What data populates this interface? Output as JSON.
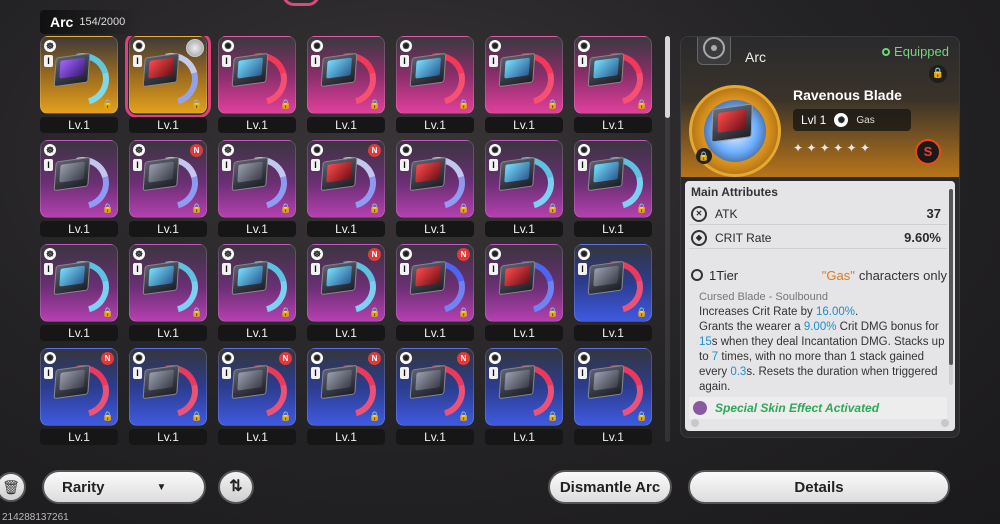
{
  "header": {
    "title": "Arc",
    "count": "154/2000"
  },
  "grid": {
    "items": [
      {
        "lv": "Lv.1",
        "bg": "gold",
        "ring": "c-cyan",
        "face": "violet",
        "elem": "☸",
        "badge": "",
        "selected": false
      },
      {
        "lv": "Lv.1",
        "bg": "gold",
        "ring": "c-white",
        "face": "red",
        "elem": "✺",
        "badge": "deco",
        "selected": true
      },
      {
        "lv": "Lv.1",
        "bg": "pink",
        "ring": "c-red",
        "face": "cyan",
        "elem": "✺",
        "badge": "",
        "selected": false
      },
      {
        "lv": "Lv.1",
        "bg": "pink",
        "ring": "c-red",
        "face": "cyan",
        "elem": "✺",
        "badge": "",
        "selected": false
      },
      {
        "lv": "Lv.1",
        "bg": "pink",
        "ring": "c-red",
        "face": "cyan",
        "elem": "✺",
        "badge": "",
        "selected": false
      },
      {
        "lv": "Lv.1",
        "bg": "pink",
        "ring": "c-red",
        "face": "cyan",
        "elem": "✺",
        "badge": "",
        "selected": false
      },
      {
        "lv": "Lv.1",
        "bg": "pink",
        "ring": "c-red",
        "face": "cyan",
        "elem": "✺",
        "badge": "",
        "selected": false
      },
      {
        "lv": "Lv.1",
        "bg": "purple",
        "ring": "c-white",
        "face": "gray",
        "elem": "☸",
        "badge": "",
        "selected": false
      },
      {
        "lv": "Lv.1",
        "bg": "purple",
        "ring": "c-white",
        "face": "gray",
        "elem": "☸",
        "badge": "N",
        "selected": false
      },
      {
        "lv": "Lv.1",
        "bg": "purple",
        "ring": "c-white",
        "face": "gray",
        "elem": "☸",
        "badge": "",
        "selected": false
      },
      {
        "lv": "Lv.1",
        "bg": "purple",
        "ring": "c-white",
        "face": "red",
        "elem": "✺",
        "badge": "N",
        "selected": false
      },
      {
        "lv": "Lv.1",
        "bg": "purple",
        "ring": "c-white",
        "face": "red",
        "elem": "✺",
        "badge": "",
        "selected": false
      },
      {
        "lv": "Lv.1",
        "bg": "purple",
        "ring": "c-cyan",
        "face": "cyan",
        "elem": "✺",
        "badge": "",
        "selected": false
      },
      {
        "lv": "Lv.1",
        "bg": "purple",
        "ring": "c-cyan",
        "face": "cyan",
        "elem": "✺",
        "badge": "",
        "selected": false
      },
      {
        "lv": "Lv.1",
        "bg": "purple",
        "ring": "c-cyan",
        "face": "cyan",
        "elem": "☸",
        "badge": "",
        "selected": false
      },
      {
        "lv": "Lv.1",
        "bg": "purple",
        "ring": "c-cyan",
        "face": "cyan",
        "elem": "☸",
        "badge": "",
        "selected": false
      },
      {
        "lv": "Lv.1",
        "bg": "purple",
        "ring": "c-cyan",
        "face": "cyan",
        "elem": "☸",
        "badge": "",
        "selected": false
      },
      {
        "lv": "Lv.1",
        "bg": "purple",
        "ring": "c-cyan",
        "face": "cyan",
        "elem": "☸",
        "badge": "N",
        "selected": false
      },
      {
        "lv": "Lv.1",
        "bg": "purple",
        "ring": "c-blue",
        "face": "red",
        "elem": "✺",
        "badge": "N",
        "selected": false
      },
      {
        "lv": "Lv.1",
        "bg": "purple",
        "ring": "c-blue",
        "face": "red",
        "elem": "✺",
        "badge": "",
        "selected": false
      },
      {
        "lv": "Lv.1",
        "bg": "blue",
        "ring": "c-red",
        "face": "gray",
        "elem": "✺",
        "badge": "",
        "selected": false
      },
      {
        "lv": "Lv.1",
        "bg": "blue",
        "ring": "c-red",
        "face": "gray",
        "elem": "✺",
        "badge": "N",
        "selected": false
      },
      {
        "lv": "Lv.1",
        "bg": "blue",
        "ring": "c-red",
        "face": "gray",
        "elem": "✺",
        "badge": "",
        "selected": false
      },
      {
        "lv": "Lv.1",
        "bg": "blue",
        "ring": "c-red",
        "face": "gray",
        "elem": "✺",
        "badge": "N",
        "selected": false
      },
      {
        "lv": "Lv.1",
        "bg": "blue",
        "ring": "c-red",
        "face": "gray",
        "elem": "✺",
        "badge": "N",
        "selected": false
      },
      {
        "lv": "Lv.1",
        "bg": "blue",
        "ring": "c-red",
        "face": "gray",
        "elem": "✺",
        "badge": "N",
        "selected": false
      },
      {
        "lv": "Lv.1",
        "bg": "blue",
        "ring": "c-red",
        "face": "gray",
        "elem": "✺",
        "badge": "",
        "selected": false
      },
      {
        "lv": "Lv.1",
        "bg": "blue",
        "ring": "c-red",
        "face": "gray",
        "elem": "✺",
        "badge": "",
        "selected": false
      }
    ]
  },
  "panel": {
    "type_label": "Arc",
    "equipped": "Equipped",
    "name": "Ravenous Blade",
    "level": "Lvl 1",
    "element": "Gas",
    "stars": "✦ ✦ ✦ ✦ ✦ ✦",
    "main_attributes_title": "Main Attributes",
    "attributes": [
      {
        "name": "ATK",
        "value": "37",
        "icon": "atk-icon"
      },
      {
        "name": "CRIT Rate",
        "value": "9.60%",
        "icon": "crit-icon"
      }
    ],
    "tier": "1Tier",
    "restriction_quote": "\"Gas\"",
    "restriction_rest": "characters only",
    "skill_name": "Cursed Blade - Soulbound",
    "desc": {
      "p1": "Increases Crit Rate by ",
      "v1": "16.00%",
      "p2": ".",
      "p3": "Grants the wearer a ",
      "v2": "9.00%",
      "p4": " Crit DMG bonus for ",
      "v3": "15",
      "p5": "s when they deal Incantation DMG. Stacks up to ",
      "v4": "7",
      "p6": " times, with no more than 1 stack gained every ",
      "v5": "0.3",
      "p7": "s. Resets the duration when triggered again."
    },
    "skin_effect": "Special Skin Effect Activated"
  },
  "bottom": {
    "rarity": "Rarity",
    "dismantle": "Dismantle Arc",
    "details": "Details",
    "uid": "214288137261"
  },
  "colors": {
    "accent": "#e0407c",
    "gold": "#e3a11c",
    "green": "#6fd67a",
    "highlight": "#1a8fcf"
  }
}
